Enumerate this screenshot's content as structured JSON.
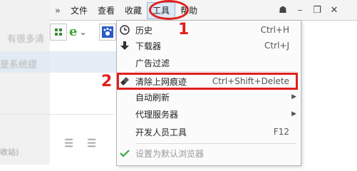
{
  "menubar": {
    "overflow_glyph": "»",
    "items": [
      {
        "label": "文件"
      },
      {
        "label": "查看"
      },
      {
        "label": "收藏"
      },
      {
        "label": "工具"
      },
      {
        "label": "帮助"
      }
    ]
  },
  "window_controls": {
    "skin": "☗",
    "minimize": "–",
    "restore": "❐",
    "close": "✕"
  },
  "background": {
    "line1": "有很多清",
    "line2": "是系统提",
    "footer": "收站)",
    "list_icon": "☰"
  },
  "tools_menu": {
    "items": [
      {
        "label": "历史",
        "shortcut": "Ctrl+H",
        "icon": "clock-icon"
      },
      {
        "label": "下载器",
        "shortcut": "Ctrl+J",
        "icon": "download-arrow-icon"
      },
      {
        "label": "广告过滤",
        "shortcut": "",
        "icon": ""
      },
      {
        "label": "清除上网痕迹",
        "shortcut": "Ctrl+Shift+Delete",
        "icon": "broom-icon"
      },
      {
        "label": "自动刷新",
        "shortcut": "",
        "icon": "",
        "submenu": true
      },
      {
        "label": "代理服务器",
        "shortcut": "",
        "icon": "",
        "submenu": true
      },
      {
        "label": "开发人员工具",
        "shortcut": "F12",
        "icon": ""
      },
      {
        "label": "设置为默认浏览器",
        "shortcut": "",
        "icon": "check-icon",
        "disabled": true
      }
    ]
  },
  "annotations": {
    "step1": "1",
    "step2": "2"
  },
  "colors": {
    "annotation_red": "#e0201c",
    "menu_bg": "#fbfbfb"
  }
}
